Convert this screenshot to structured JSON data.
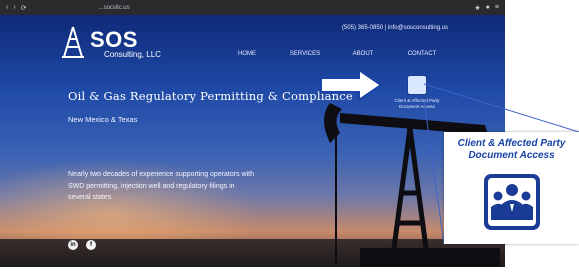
{
  "browser": {
    "url": "...socsllc.us",
    "nav_icons": [
      "back-icon",
      "forward-icon",
      "reload-icon"
    ]
  },
  "site": {
    "logo": {
      "name": "SOS",
      "sub": "Consulting, LLC"
    },
    "contact_line": "(505) 365-0850  |  info@sosconsulting.us",
    "menu": [
      "HOME",
      "SERVICES",
      "ABOUT",
      "CONTACT"
    ],
    "hero_title": "Oil & Gas Regulatory Permitting & Compliance",
    "hero_subtitle": "New Mexico & Texas",
    "hero_body": "Nearly two decades of experience supporting operators with SWD permitting, injection well and regulatory filings in several states.",
    "social": [
      {
        "icon": "linkedin-icon",
        "text": "in"
      },
      {
        "icon": "facebook-icon",
        "text": "f"
      }
    ],
    "portal_small_label": "Client & Affected Party Document Access"
  },
  "callout": {
    "title": "Client & Affected Party Document Access",
    "icon": "people-group-icon"
  },
  "colors": {
    "accent": "#1a43a6",
    "sky_top": "#0f2a78",
    "sky_mid": "#3a62b4",
    "sunset": "#c78a6a"
  }
}
